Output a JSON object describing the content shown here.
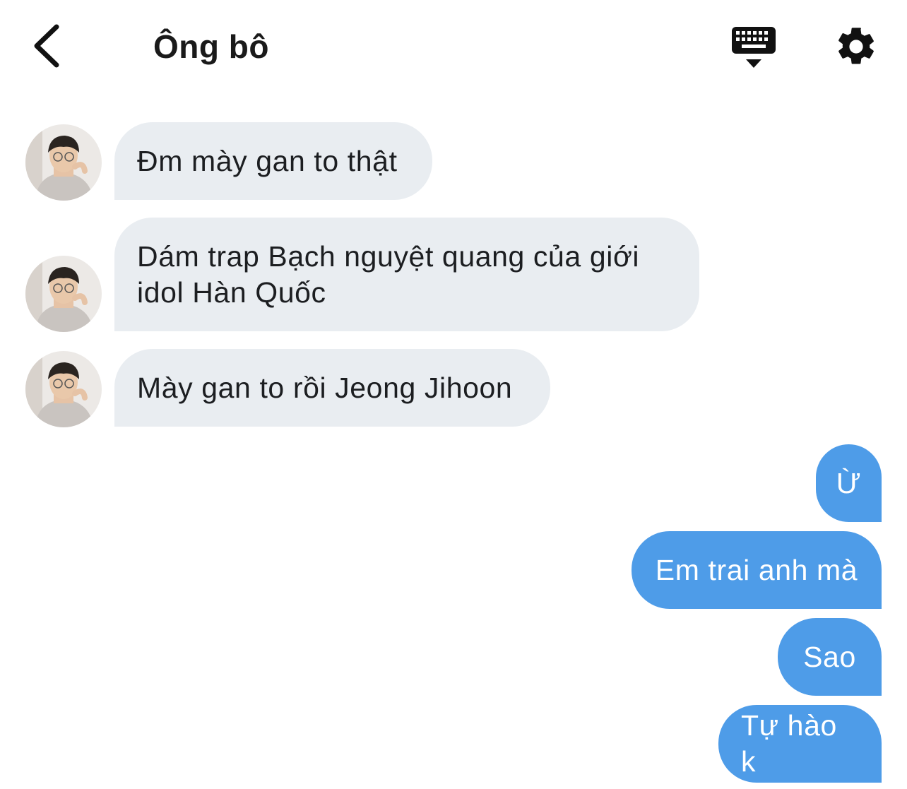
{
  "header": {
    "title": "Ông bô",
    "back_icon": "chevron-left-icon",
    "keyboard_icon": "keyboard-icon",
    "settings_icon": "gear-icon"
  },
  "messages": {
    "incoming": [
      {
        "text": "Đm mày gan to thật"
      },
      {
        "text": "Dám trap Bạch nguyệt quang của giới idol Hàn Quốc"
      },
      {
        "text": "Mày gan to rồi Jeong Jihoon"
      }
    ],
    "outgoing": [
      {
        "text": "Ừ"
      },
      {
        "text": "Em trai anh mà"
      },
      {
        "text": "Sao"
      },
      {
        "text": "Tự hào k"
      }
    ]
  },
  "colors": {
    "incoming_bubble": "#e9edf1",
    "outgoing_bubble": "#4e9ce8",
    "outgoing_text": "#ffffff",
    "header_icon": "#111111"
  }
}
